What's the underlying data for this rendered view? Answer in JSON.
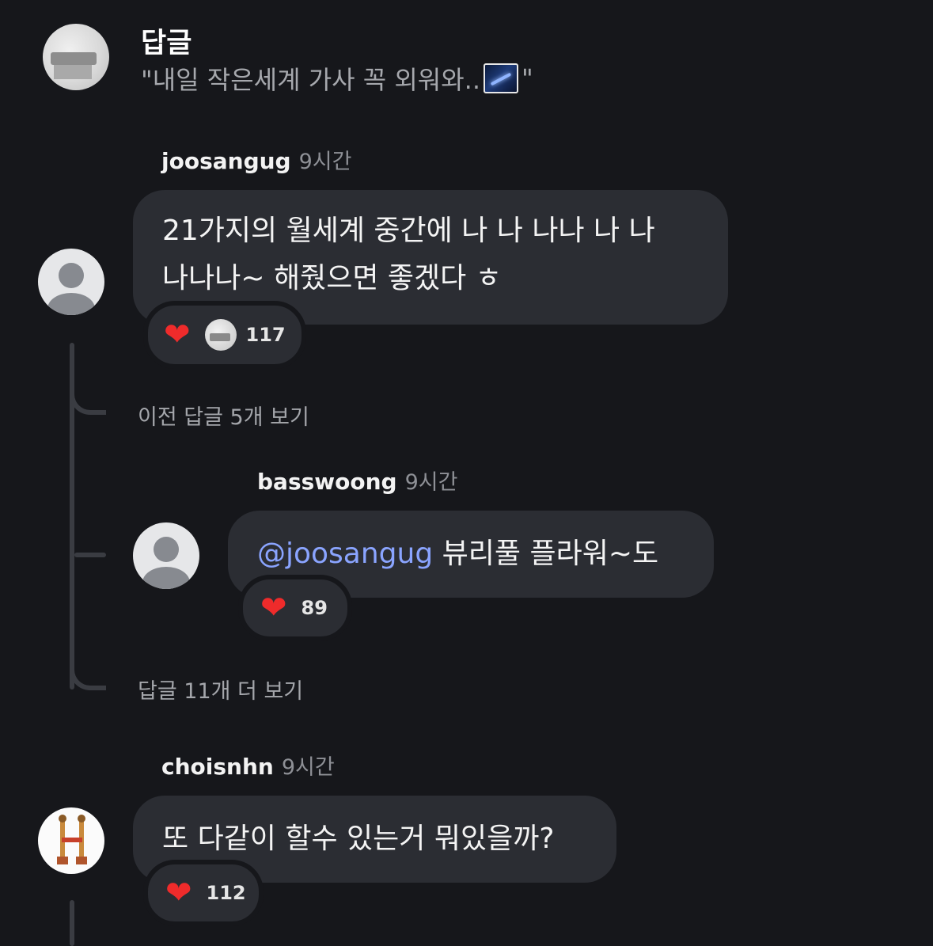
{
  "header": {
    "title": "답글",
    "subtitle_open": "\"내일 작은세계 가사 꼭 외워와..",
    "subtitle_close": "\""
  },
  "comments": [
    {
      "username": "joosangug",
      "time": "9시간",
      "text_line1": "21가지의 월세계 중간에 나 나 나나 나 나",
      "text_line2": "나나나~ 해줬으면 좋겠다 ㅎ",
      "likes": "117"
    },
    {
      "username": "basswoong",
      "time": "9시간",
      "mention": "@joosangug",
      "text": " 뷰리풀 플라워~도",
      "likes": "89"
    },
    {
      "username": "choisnhn",
      "time": "9시간",
      "text": "또 다같이 할수 있는거 뭐있을까?",
      "likes": "112"
    }
  ],
  "thread": {
    "previous_replies": "이전 답글 5개 보기",
    "more_replies": "답글 11개 더 보기"
  },
  "colors": {
    "background": "#16171b",
    "bubble": "#2b2d33",
    "heart": "#ef2b2b",
    "mention": "#8aa4ff"
  }
}
